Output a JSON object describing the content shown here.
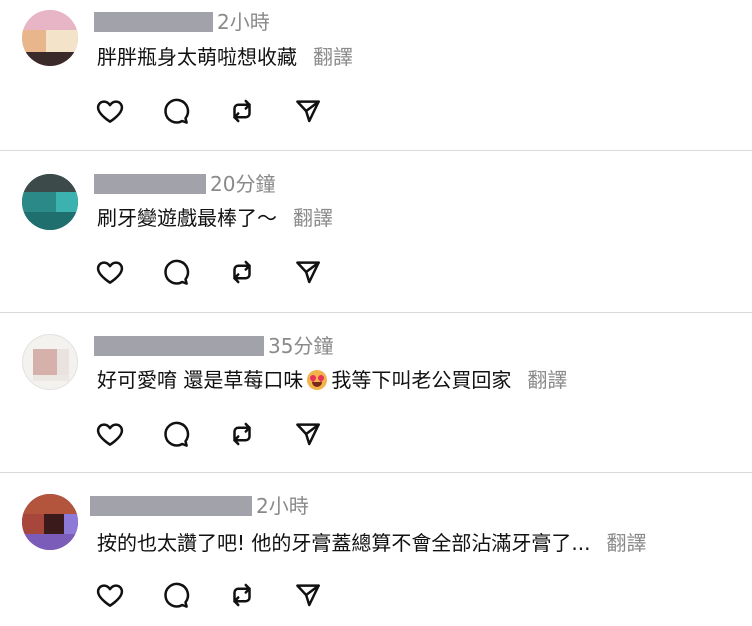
{
  "comments": [
    {
      "time": "2小時",
      "text": "胖胖瓶身太萌啦想收藏",
      "translate": "翻譯"
    },
    {
      "time": "20分鐘",
      "text": "刷牙變遊戲最棒了～",
      "translate": "翻譯"
    },
    {
      "time": "35分鐘",
      "text_before": "好可愛唷 還是草莓口味",
      "emoji": "smiling-face-with-heart-eyes",
      "text_after": " 我等下叫老公買回家",
      "translate": "翻譯"
    },
    {
      "time": "2小時",
      "text": "按的也太讚了吧! 他的牙膏蓋總算不會全部沾滿牙膏了...",
      "translate": "翻譯"
    }
  ],
  "actions": {
    "like_icon": "heart-icon",
    "reply_icon": "comment-bubble-icon",
    "repost_icon": "repost-icon",
    "share_icon": "send-icon"
  },
  "colors": {
    "redaction": "#a2a3aa",
    "muted_text": "#8a8a8a",
    "divider": "#d9d9d9"
  }
}
